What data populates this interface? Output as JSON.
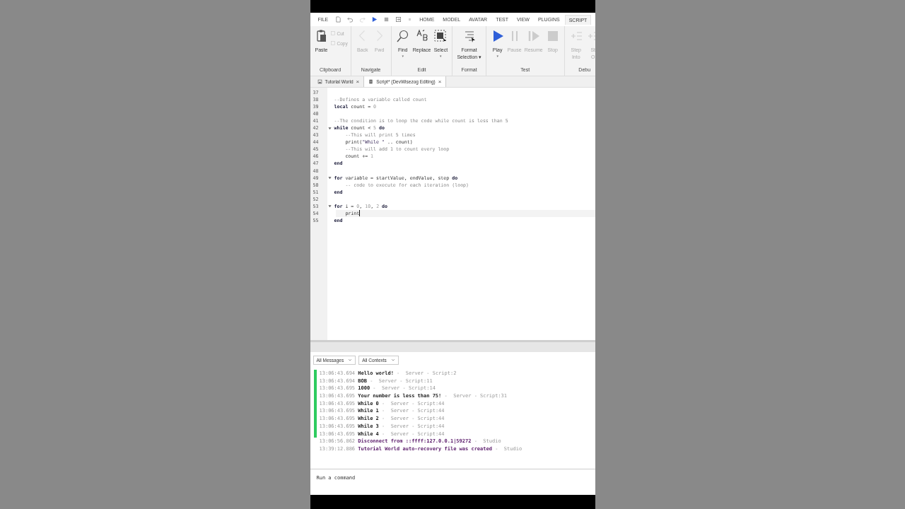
{
  "menu": {
    "file": "FILE",
    "tabs": [
      {
        "label": "HOME",
        "selected": false
      },
      {
        "label": "MODEL",
        "selected": false
      },
      {
        "label": "AVATAR",
        "selected": false
      },
      {
        "label": "TEST",
        "selected": false
      },
      {
        "label": "VIEW",
        "selected": false
      },
      {
        "label": "PLUGINS",
        "selected": false
      },
      {
        "label": "SCRIPT",
        "selected": true
      }
    ]
  },
  "ribbon": [
    {
      "label": "Clipboard",
      "buttons": [
        {
          "kind": "large",
          "label": [
            "Paste"
          ],
          "disabled": false
        },
        {
          "kind": "small",
          "label": [
            "Cut"
          ],
          "disabled": true
        },
        {
          "kind": "small",
          "label": [
            "Copy"
          ],
          "disabled": true
        }
      ]
    },
    {
      "label": "Navigate",
      "buttons": [
        {
          "kind": "large",
          "label": [
            "Back"
          ],
          "disabled": true
        },
        {
          "kind": "large",
          "label": [
            "Fwd"
          ],
          "disabled": true
        }
      ]
    },
    {
      "label": "Edit",
      "buttons": [
        {
          "kind": "large",
          "label": [
            "Find"
          ],
          "disabled": false,
          "caret": "▾"
        },
        {
          "kind": "large",
          "label": [
            "Replace"
          ],
          "disabled": false
        },
        {
          "kind": "large",
          "label": [
            "Select"
          ],
          "disabled": false,
          "caret": "▾"
        }
      ]
    },
    {
      "label": "Format",
      "buttons": [
        {
          "kind": "large",
          "label": [
            "Format",
            "Selection ▾"
          ],
          "disabled": false
        }
      ]
    },
    {
      "label": "Test",
      "buttons": [
        {
          "kind": "large",
          "label": [
            "Play"
          ],
          "disabled": false,
          "caret": "▾"
        },
        {
          "kind": "large",
          "label": [
            "Pause"
          ],
          "disabled": true
        },
        {
          "kind": "large",
          "label": [
            "Resume"
          ],
          "disabled": true
        },
        {
          "kind": "large",
          "label": [
            "Stop"
          ],
          "disabled": true
        }
      ]
    },
    {
      "label": "Debu",
      "buttons": [
        {
          "kind": "large",
          "label": [
            "Step",
            "Into"
          ],
          "disabled": true
        },
        {
          "kind": "large",
          "label": [
            "St",
            "O"
          ],
          "disabled": true
        }
      ]
    }
  ],
  "documents": [
    {
      "title": "Tutorial World",
      "selected": false,
      "close": "×"
    },
    {
      "title": "Script* (DevWisezog Editing)",
      "selected": true,
      "close": "×"
    }
  ],
  "editor": {
    "lines": [
      {
        "number": "37",
        "foldable": false,
        "current": false
      },
      {
        "number": "38",
        "foldable": false,
        "current": false,
        "tokens": [
          {
            "kind": "comment",
            "text": "--Defines a variable called count"
          }
        ]
      },
      {
        "number": "39",
        "foldable": false,
        "current": false,
        "tokens": [
          {
            "kind": "keyword",
            "text": "local"
          },
          {
            "kind": "plain",
            "text": " count = "
          },
          {
            "kind": "number",
            "text": "0"
          }
        ]
      },
      {
        "number": "40",
        "foldable": false,
        "current": false
      },
      {
        "number": "41",
        "foldable": false,
        "current": false,
        "tokens": [
          {
            "kind": "comment",
            "text": "--The condition is to loop the code while count is less than 5"
          }
        ]
      },
      {
        "number": "42",
        "foldable": true,
        "current": false,
        "tokens": [
          {
            "kind": "keyword",
            "text": "while"
          },
          {
            "kind": "plain",
            "text": " count < "
          },
          {
            "kind": "number",
            "text": "5"
          },
          {
            "kind": "keyword",
            "text": " do"
          }
        ]
      },
      {
        "number": "43",
        "foldable": false,
        "current": false,
        "tokens": [
          {
            "kind": "comment",
            "text": "    --This will print 5 times"
          }
        ]
      },
      {
        "number": "44",
        "foldable": false,
        "current": false,
        "tokens": [
          {
            "kind": "plain",
            "text": "    print("
          },
          {
            "kind": "string",
            "text": "\"While \""
          },
          {
            "kind": "plain",
            "text": " .. count)"
          }
        ]
      },
      {
        "number": "45",
        "foldable": false,
        "current": false,
        "tokens": [
          {
            "kind": "comment",
            "text": "    --This will add 1 to count every loop"
          }
        ]
      },
      {
        "number": "46",
        "foldable": false,
        "current": false,
        "tokens": [
          {
            "kind": "plain",
            "text": "    count += "
          },
          {
            "kind": "number",
            "text": "1"
          }
        ]
      },
      {
        "number": "47",
        "foldable": false,
        "current": false,
        "tokens": [
          {
            "kind": "keyword",
            "text": "end"
          }
        ]
      },
      {
        "number": "48",
        "foldable": false,
        "current": false
      },
      {
        "number": "49",
        "foldable": true,
        "current": false,
        "tokens": [
          {
            "kind": "keyword",
            "text": "for"
          },
          {
            "kind": "plain",
            "text": " variable = startValue, endValue, step "
          },
          {
            "kind": "keyword",
            "text": "do"
          }
        ]
      },
      {
        "number": "50",
        "foldable": false,
        "current": false,
        "tokens": [
          {
            "kind": "comment",
            "text": "    -- code to execute for each iteration (loop)"
          }
        ]
      },
      {
        "number": "51",
        "foldable": false,
        "current": false,
        "tokens": [
          {
            "kind": "keyword",
            "text": "end"
          }
        ]
      },
      {
        "number": "52",
        "foldable": false,
        "current": false
      },
      {
        "number": "53",
        "foldable": true,
        "current": false,
        "tokens": [
          {
            "kind": "keyword",
            "text": "for"
          },
          {
            "kind": "plain",
            "text": " i = "
          },
          {
            "kind": "number",
            "text": "0"
          },
          {
            "kind": "plain",
            "text": ", "
          },
          {
            "kind": "number",
            "text": "10"
          },
          {
            "kind": "plain",
            "text": ", "
          },
          {
            "kind": "number",
            "text": "2"
          },
          {
            "kind": "keyword",
            "text": " do"
          }
        ]
      },
      {
        "number": "54",
        "foldable": false,
        "current": true,
        "tokens": [
          {
            "kind": "plain",
            "text": "    print"
          }
        ]
      },
      {
        "number": "55",
        "foldable": false,
        "current": false,
        "tokens": [
          {
            "kind": "keyword",
            "text": "end"
          }
        ]
      }
    ]
  },
  "output": {
    "filters": [
      "All Messages",
      "All Contexts"
    ],
    "rows": [
      {
        "kind": "print",
        "time": "13:06:43.694",
        "message": "Hello world!",
        "source": " -  Server - Script:2"
      },
      {
        "kind": "print",
        "time": "13:06:43.694",
        "message": "BOB",
        "source": " -  Server - Script:11"
      },
      {
        "kind": "print",
        "time": "13:06:43.695",
        "message": "1000",
        "source": " -  Server - Script:14"
      },
      {
        "kind": "print",
        "time": "13:06:43.695",
        "message": "Your number is less than 75!",
        "source": " -  Server - Script:31"
      },
      {
        "kind": "print",
        "time": "13:06:43.695",
        "message": "While 0",
        "source": " -  Server - Script:44"
      },
      {
        "kind": "print",
        "time": "13:06:43.695",
        "message": "While 1",
        "source": " -  Server - Script:44"
      },
      {
        "kind": "print",
        "time": "13:06:43.695",
        "message": "While 2",
        "source": " -  Server - Script:44"
      },
      {
        "kind": "print",
        "time": "13:06:43.695",
        "message": "While 3",
        "source": " -  Server - Script:44"
      },
      {
        "kind": "print",
        "time": "13:06:43.695",
        "message": "While 4",
        "source": " -  Server - Script:44"
      },
      {
        "kind": "info",
        "time": "13:06:56.862",
        "message": "Disconnect from ::ffff:127.0.0.1|59272",
        "source": " -  Studio"
      },
      {
        "kind": "info",
        "time": "13:39:12.886",
        "message": "Tutorial World auto-recovery file was created",
        "source": " -  Studio"
      }
    ]
  },
  "command": {
    "placeholder": "Run a command"
  }
}
